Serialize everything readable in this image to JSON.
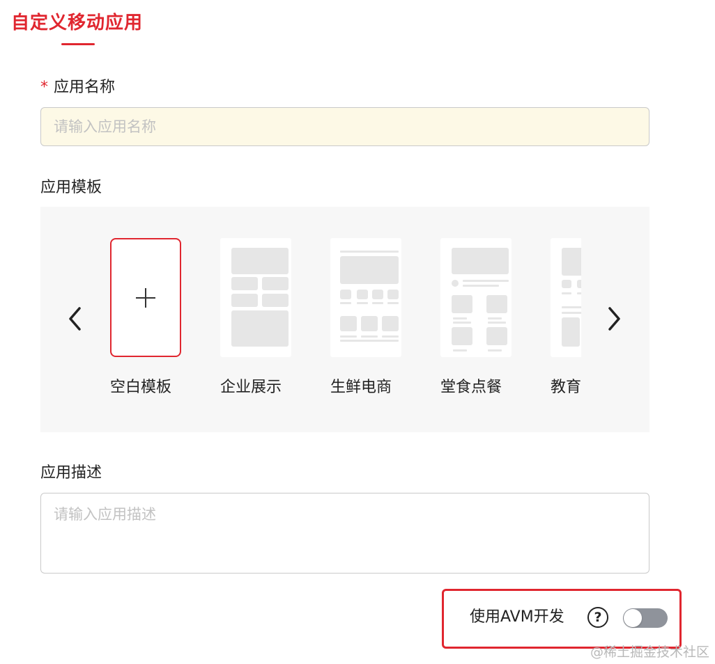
{
  "tab": {
    "title": "自定义移动应用"
  },
  "form": {
    "name": {
      "required_mark": "*",
      "label": "应用名称",
      "placeholder": "请输入应用名称",
      "value": ""
    },
    "template": {
      "label": "应用模板",
      "prev_icon": "chevron-left-icon",
      "next_icon": "chevron-right-icon",
      "add_icon": "plus-icon",
      "selected_index": 0,
      "items": [
        {
          "label": "空白模板"
        },
        {
          "label": "企业展示"
        },
        {
          "label": "生鲜电商"
        },
        {
          "label": "堂食点餐"
        },
        {
          "label": "教育"
        }
      ]
    },
    "description": {
      "label": "应用描述",
      "placeholder": "请输入应用描述",
      "value": ""
    },
    "avm": {
      "label": "使用AVM开发",
      "help_icon": "question-circle-icon",
      "help_glyph": "?",
      "enabled": false
    }
  },
  "colors": {
    "accent": "#e0262f",
    "toggle_off": "#8f939b",
    "panel_bg": "#f7f7f7",
    "input_highlight": "#fdf9e6"
  },
  "watermark": "@稀土掘金技术社区"
}
